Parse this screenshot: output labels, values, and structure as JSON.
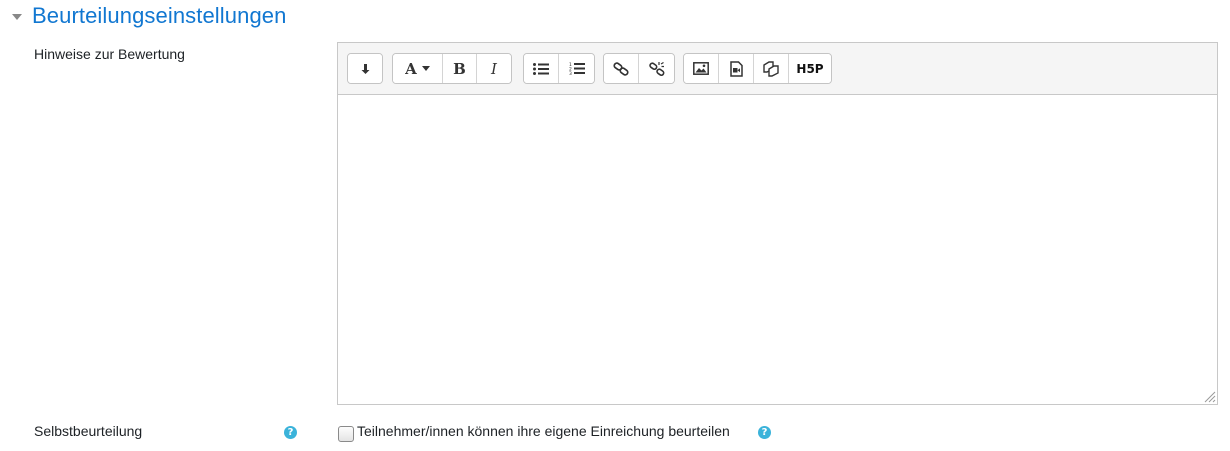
{
  "section": {
    "title": "Beurteilungseinstellungen"
  },
  "grading_hints": {
    "label": "Hinweise zur Bewertung",
    "toolbar": {
      "show_more": "show-more-icon",
      "font_color_label": "A",
      "bold_label": "B",
      "italic_label": "I",
      "unordered_list": "bullet-list-icon",
      "ordered_list": "numbered-list-icon",
      "link": "link-icon",
      "unlink": "unlink-icon",
      "image": "image-icon",
      "media": "media-icon",
      "manage_files": "manage-files-icon",
      "h5p_label": "H5P"
    },
    "content": ""
  },
  "self_assessment": {
    "label": "Selbstbeurteilung",
    "checkbox_label": "Teilnehmer/innen können ihre eigene Einreichung beurteilen",
    "checked": false,
    "help_glyph": "?"
  },
  "colors": {
    "accent": "#1177d1",
    "help": "#3bb3da"
  }
}
